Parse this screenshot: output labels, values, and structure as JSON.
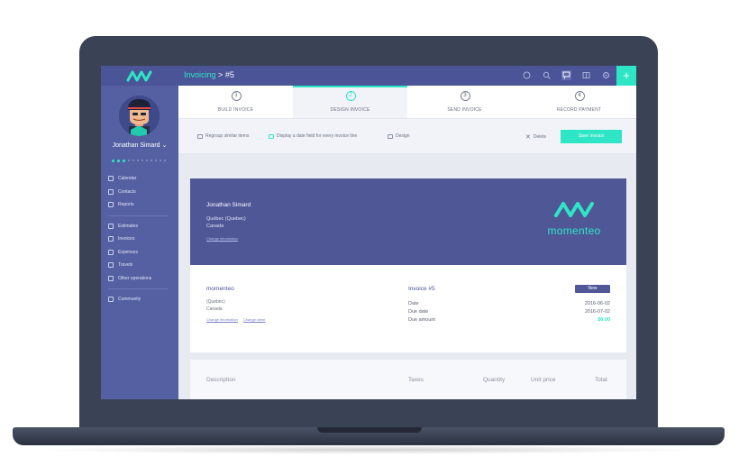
{
  "topbar": {
    "section": "Invoicing",
    "separator": ">",
    "current": "#5",
    "add_label": "+"
  },
  "sidebar": {
    "user_name": "Jonathan Simard",
    "user_caret": "⌄",
    "nav_group1": [
      {
        "label": "Calendar",
        "icon": "calendar-icon"
      },
      {
        "label": "Contacts",
        "icon": "contacts-icon"
      },
      {
        "label": "Reports",
        "icon": "reports-icon"
      }
    ],
    "nav_group2": [
      {
        "label": "Estimates",
        "icon": "estimates-icon"
      },
      {
        "label": "Invoices",
        "icon": "invoices-icon"
      },
      {
        "label": "Expenses",
        "icon": "expenses-icon"
      },
      {
        "label": "Travels",
        "icon": "travels-icon"
      },
      {
        "label": "Other operations",
        "icon": "operations-icon"
      }
    ],
    "nav_group3": [
      {
        "label": "Community",
        "icon": "community-icon"
      }
    ]
  },
  "steps": [
    {
      "num": "1",
      "label": "BUILD INVOICE"
    },
    {
      "num": "2",
      "label": "DESIGN INVOICE"
    },
    {
      "num": "3",
      "label": "SEND INVOICE"
    },
    {
      "num": "4",
      "label": "RECORD PAYMENT"
    }
  ],
  "toolbar": {
    "regroup": "Regroup similar items",
    "date_field": "Display a date field for every invoice line",
    "design": "Design",
    "delete": "Delete",
    "save": "Save invoice"
  },
  "invoice": {
    "from": {
      "name": "Jonathan Simard",
      "address1": "Québec (Quebec)",
      "address2": "Canada",
      "change": "Change information"
    },
    "brand": "momenteo",
    "client": {
      "name": "momenteo",
      "address1": "(Quebec)",
      "address2": "Canada",
      "change_info": "Change information",
      "change_client": "Change client"
    },
    "title": "Invoice #5",
    "status": "New",
    "details": [
      {
        "key": "Date",
        "value": "2016-06-02"
      },
      {
        "key": "Due date",
        "value": "2016-07-02"
      },
      {
        "key": "Due amount",
        "value": "$0.00"
      }
    ],
    "columns": {
      "description": "Description",
      "taxes": "Taxes",
      "quantity": "Quantity",
      "unit_price": "Unit price",
      "total": "Total"
    }
  },
  "colors": {
    "accent": "#2ee6c6",
    "sidebar": "#5560a3",
    "header": "#4f5797"
  }
}
